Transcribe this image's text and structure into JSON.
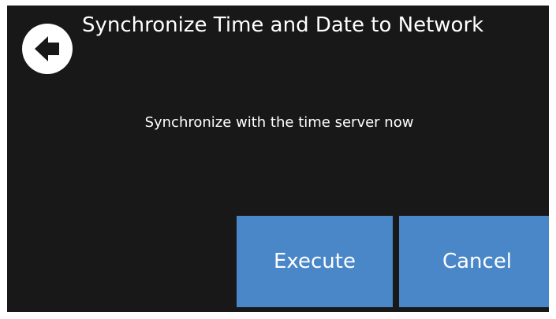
{
  "header": {
    "title": "Synchronize Time and Date to Network",
    "back_icon": "back-arrow-icon"
  },
  "main": {
    "message": "Synchronize with the time server now"
  },
  "actions": {
    "execute_label": "Execute",
    "cancel_label": "Cancel"
  },
  "colors": {
    "background": "#181818",
    "button": "#4a87c9",
    "text": "#ffffff"
  }
}
